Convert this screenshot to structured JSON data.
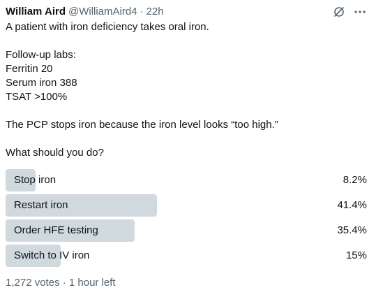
{
  "tweet": {
    "author_name": "William Aird",
    "handle": "@WilliamAird4",
    "separator": "·",
    "time": "22h",
    "lines": [
      "A patient with iron deficiency takes oral iron.",
      "",
      "Follow-up labs:",
      "Ferritin 20",
      "Serum iron 388",
      "TSAT >100%",
      "",
      "The PCP stops iron because the iron level looks “too high.”",
      "",
      "What should you do?"
    ]
  },
  "poll": {
    "options": [
      {
        "label": "Stop iron",
        "percent_text": "8.2%",
        "percent": 8.2
      },
      {
        "label": "Restart iron",
        "percent_text": "41.4%",
        "percent": 41.4
      },
      {
        "label": "Order HFE testing",
        "percent_text": "35.4%",
        "percent": 35.4
      },
      {
        "label": "Switch to IV iron",
        "percent_text": "15%",
        "percent": 15
      }
    ],
    "footer": "1,272 votes · 1 hour left"
  },
  "icons": [
    "grok-icon",
    "more-icon"
  ],
  "colors": {
    "bar": "#cfd9de",
    "secondary_text": "#536471",
    "primary_text": "#0f1419"
  }
}
